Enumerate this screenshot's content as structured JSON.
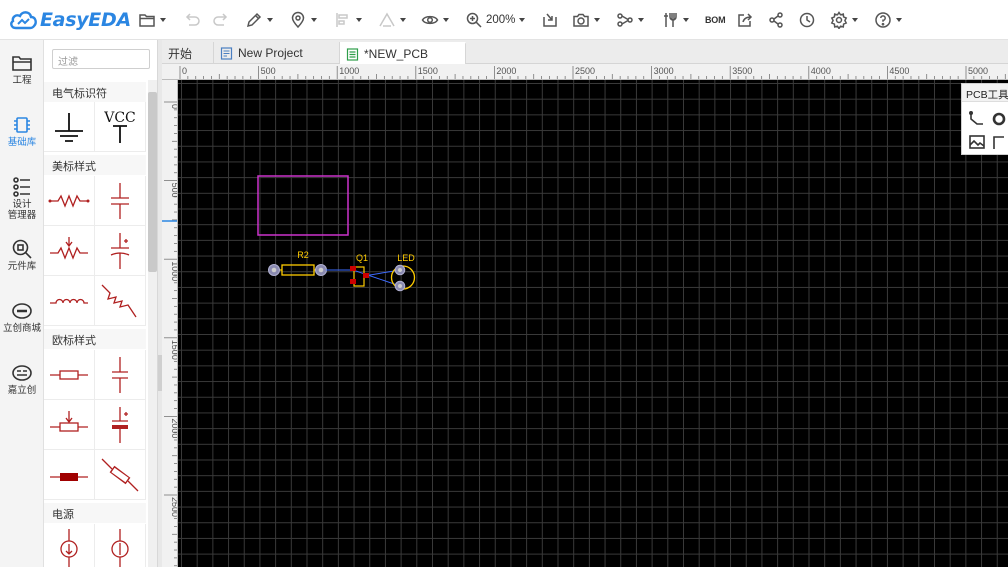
{
  "app": {
    "logo_text": "EasyEDA"
  },
  "toolbar": {
    "zoom_label": "200%",
    "bom_label": "BOM"
  },
  "leftnav": {
    "items": [
      {
        "label": "工程",
        "active": false
      },
      {
        "label": "基础库",
        "active": true
      },
      {
        "label": "设计\n管理器",
        "active": false
      },
      {
        "label": "元件库",
        "active": false
      },
      {
        "label": "立创商城",
        "active": false
      },
      {
        "label": "嘉立创",
        "active": false
      }
    ]
  },
  "library": {
    "filter_placeholder": "过滤",
    "sections": [
      {
        "title": "电气标识符"
      },
      {
        "title": "美标样式"
      },
      {
        "title": "欧标样式"
      },
      {
        "title": "电源"
      }
    ],
    "vcc_label": "VCC"
  },
  "tabs": [
    {
      "label": "开始",
      "active": false
    },
    {
      "label": "New Project",
      "active": false
    },
    {
      "label": "*NEW_PCB",
      "active": true
    }
  ],
  "ruler": {
    "h_labels": [
      "0",
      "500",
      "1000",
      "1500",
      "2000",
      "2500",
      "3000",
      "3500",
      "4000",
      "4500",
      "5000"
    ],
    "v_labels": [
      "0",
      "500",
      "1000",
      "1500",
      "2000",
      "2500"
    ]
  },
  "pcb": {
    "designators": {
      "r2": "R2",
      "q1": "Q1",
      "led": "LED"
    }
  },
  "pcb_tools": {
    "title": "PCB工具"
  },
  "colors": {
    "accent": "#2b86e2",
    "canvas_bg": "#000000",
    "board_outline": "#cc33cc",
    "silkscreen": "#ffcc00",
    "pad_top": "#cc0000",
    "pad_multi": "#b0b0d0",
    "ratline": "#3d6bff"
  }
}
